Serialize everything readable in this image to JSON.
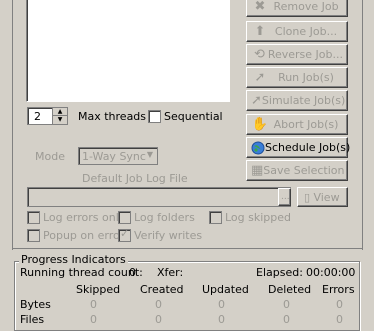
{
  "buttons": [
    {
      "label": "Remove Job",
      "icon": "remove-x-icon",
      "enabled": false
    },
    {
      "label": "Clone Job...",
      "icon": "clone-icon",
      "enabled": false
    },
    {
      "label": "Reverse Job...",
      "icon": "reverse-icon",
      "enabled": false
    },
    {
      "label": "Run Job(s)",
      "icon": "run-icon",
      "enabled": false
    },
    {
      "label": "Simulate Job(s)",
      "icon": "simulate-icon",
      "enabled": false
    },
    {
      "label": "Abort Job(s)",
      "icon": "hand-icon",
      "enabled": false
    },
    {
      "label": "Schedule Job(s)",
      "icon": "globe-icon",
      "enabled": true
    },
    {
      "label": "Save Selection",
      "icon": "save-icon",
      "enabled": false
    }
  ],
  "threads": {
    "value": "2",
    "label": "Max threads"
  },
  "sequential": {
    "label": "Sequential"
  },
  "mode": {
    "label": "Mode",
    "value": "1-Way Sync"
  },
  "log": {
    "default_label": "Default Job Log File",
    "browse_label": "...",
    "view_label": "View",
    "options": [
      "Log errors only",
      "Log folders",
      "Log skipped",
      "Popup on error",
      "Verify writes"
    ]
  },
  "progress": {
    "title": "Progress Indicators",
    "running_label": "Running thread count:",
    "running_value": "0",
    "xfer_label": "Xfer:",
    "elapsed_label": "Elapsed:",
    "elapsed_value": "00:00:00",
    "columns": [
      "Skipped",
      "Created",
      "Updated",
      "Deleted",
      "Errors"
    ],
    "rows": [
      {
        "label": "Bytes",
        "values": [
          "0",
          "0",
          "0",
          "0",
          "0"
        ]
      },
      {
        "label": "Files",
        "values": [
          "0",
          "0",
          "0",
          "0",
          "0"
        ]
      }
    ]
  }
}
